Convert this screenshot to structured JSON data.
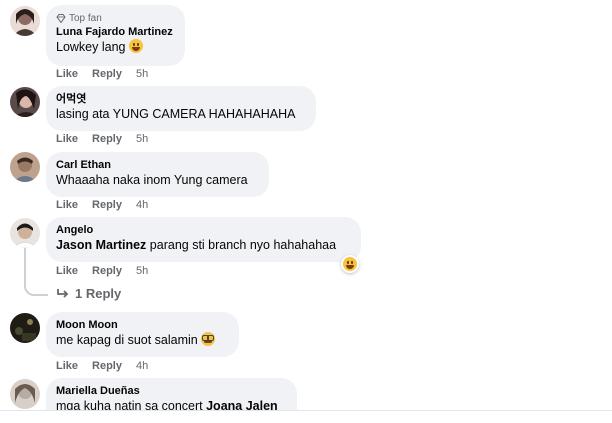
{
  "comments": [
    {
      "badge": "Top fan",
      "author": "Luna Fajardo Martinez",
      "text": "Lowkey lang",
      "like": "Like",
      "reply": "Reply",
      "time": "5h",
      "avatar_color": "#8a6a62"
    },
    {
      "author": "어먹엿",
      "text": "lasing ata YUNG CAMERA HAHAHAHAHA",
      "like": "Like",
      "reply": "Reply",
      "time": "5h",
      "avatar_color": "#3a2a2a"
    },
    {
      "author": "Carl Ethan",
      "text": "Whaaaha naka inom Yung camera",
      "like": "Like",
      "reply": "Reply",
      "time": "4h",
      "avatar_color": "#9a7a66"
    },
    {
      "author": "Angelo",
      "mention": "Jason Martinez",
      "text": "parang sti branch nyo hahahahaa",
      "like": "Like",
      "reply": "Reply",
      "time": "5h",
      "avatar_color": "#cfc3b6"
    },
    {
      "author": "Moon Moon",
      "text": "me kapag di suot salamin",
      "like": "Like",
      "reply": "Reply",
      "time": "4h",
      "avatar_color": "#2e2a1e"
    },
    {
      "author": "Mariella Dueñas",
      "text": "mga kuha natin sa concert",
      "mention": "Joana Jalen",
      "avatar_color": "#b5aca4"
    }
  ],
  "replies_link": "1 Reply"
}
